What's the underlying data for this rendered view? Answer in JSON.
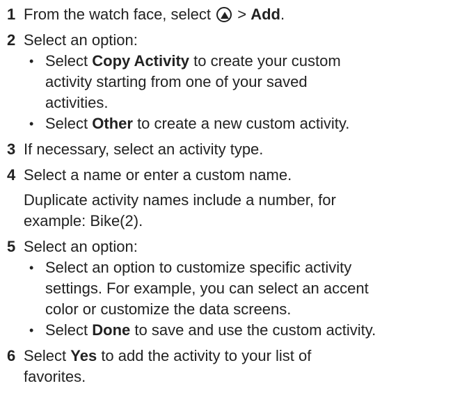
{
  "steps": [
    {
      "num": "1",
      "text_before": "From the watch face, select ",
      "icon": "up-triangle-button-icon",
      "text_mid": " > ",
      "bold": "Add",
      "text_after": "."
    },
    {
      "num": "2",
      "text": "Select an option:",
      "bullets": [
        {
          "before": "Select ",
          "bold": "Copy Activity",
          "after_line1": " to create your custom",
          "line2": "activity starting from one of your saved",
          "line3": "activities."
        },
        {
          "before": "Select ",
          "bold": "Other",
          "after": " to create a new custom activity."
        }
      ]
    },
    {
      "num": "3",
      "text": "If necessary, select an activity type."
    },
    {
      "num": "4",
      "text": "Select a name or enter a custom name.",
      "note_line1": "Duplicate activity names include a number, for",
      "note_line2": "example: Bike(2)."
    },
    {
      "num": "5",
      "text": "Select an option:",
      "bullets": [
        {
          "line1": "Select an option to customize specific activity",
          "line2": "settings. For example, you can select an accent",
          "line3": "color or customize the data screens."
        },
        {
          "before": "Select ",
          "bold": "Done",
          "after": " to save and use the custom activity."
        }
      ]
    },
    {
      "num": "6",
      "before": "Select ",
      "bold": "Yes",
      "after_line1": " to add the activity to your list of",
      "line2": "favorites."
    }
  ]
}
